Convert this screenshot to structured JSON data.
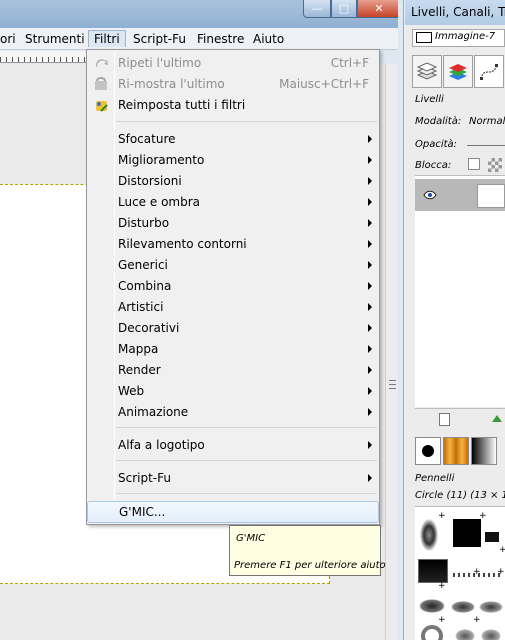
{
  "menubar": {
    "items": [
      "ori",
      "Strumenti",
      "Filtri",
      "Script-Fu",
      "Finestre",
      "Aiuto"
    ]
  },
  "filters_menu": {
    "items": [
      {
        "label": "Ripeti l'ultimo",
        "accel": "Ctrl+F",
        "disabled": true,
        "icon": "repeat-icon"
      },
      {
        "label": "Ri-mostra l'ultimo",
        "accel": "Maiusc+Ctrl+F",
        "disabled": true,
        "icon": "reshow-icon"
      },
      {
        "label": "Reimposta tutti i filtri",
        "icon": "reset-filters-icon"
      },
      {
        "label": "Sfocature",
        "submenu": true
      },
      {
        "label": "Miglioramento",
        "submenu": true
      },
      {
        "label": "Distorsioni",
        "submenu": true
      },
      {
        "label": "Luce e ombra",
        "submenu": true
      },
      {
        "label": "Disturbo",
        "submenu": true
      },
      {
        "label": "Rilevamento contorni",
        "submenu": true
      },
      {
        "label": "Generici",
        "submenu": true
      },
      {
        "label": "Combina",
        "submenu": true
      },
      {
        "label": "Artistici",
        "submenu": true
      },
      {
        "label": "Decorativi",
        "submenu": true
      },
      {
        "label": "Mappa",
        "submenu": true
      },
      {
        "label": "Render",
        "submenu": true
      },
      {
        "label": "Web",
        "submenu": true
      },
      {
        "label": "Animazione",
        "submenu": true
      },
      {
        "label": "Alfa a logotipo",
        "submenu": true
      },
      {
        "label": "Script-Fu",
        "submenu": true
      },
      {
        "label": "G'MIC...",
        "highlighted": true
      }
    ]
  },
  "tooltip": {
    "title": "G'MIC",
    "help": "Premere F1 per ulteriore aiuto"
  },
  "dock": {
    "title": "Livelli, Canali, Tra",
    "image_name": "Immagine-7",
    "layers_label": "Livelli",
    "mode_label": "Modalità:",
    "mode_value": "Normal",
    "opacity_label": "Opacità:",
    "lock_label": "Blocca:",
    "brushes_label": "Pennelli",
    "brush_info": "Circle (11) (13 × 1"
  },
  "colors": {
    "menu_bg": "#f0f0f0",
    "highlight_border": "#a9c8eb",
    "tooltip_bg": "#fffee2",
    "selection_dash": "#b0a000"
  }
}
